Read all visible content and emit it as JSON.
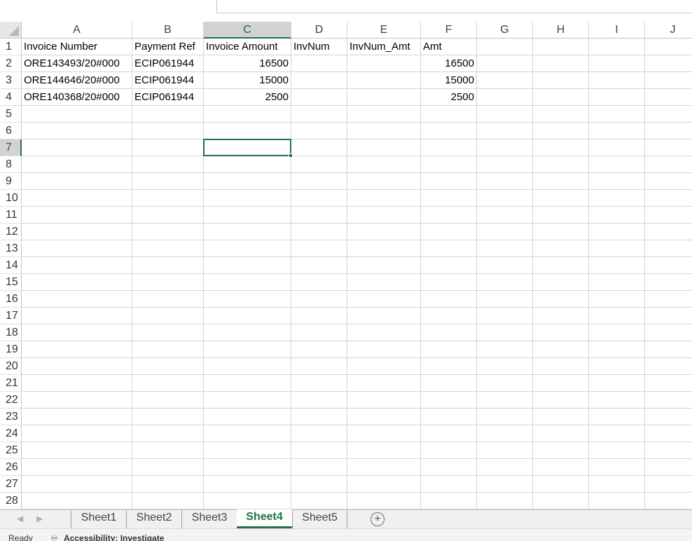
{
  "spreadsheet": {
    "columns": [
      "A",
      "B",
      "C",
      "D",
      "E",
      "F",
      "G",
      "H",
      "I",
      "J"
    ],
    "rows": [
      "1",
      "2",
      "3",
      "4",
      "5",
      "6",
      "7",
      "8",
      "9",
      "10",
      "11",
      "12",
      "13",
      "14",
      "15",
      "16",
      "17",
      "18",
      "19",
      "20",
      "21",
      "22",
      "23",
      "24",
      "25",
      "26",
      "27",
      "28"
    ],
    "selected_column": "C",
    "selected_row": "7",
    "cells": {
      "A1": "Invoice Number",
      "B1": "Payment Ref",
      "C1": "Invoice Amount",
      "D1": "InvNum",
      "E1": "InvNum_Amt",
      "F1": "Amt",
      "A2": "ORE143493/20#000",
      "B2": "ECIP061944",
      "C2": "16500",
      "F2": "16500",
      "A3": "ORE144646/20#000",
      "B3": "ECIP061944",
      "C3": "15000",
      "F3": "15000",
      "A4": "ORE140368/20#000",
      "B4": "ECIP061944",
      "C4": "2500",
      "F4": "2500"
    }
  },
  "sheet_tabs": [
    {
      "label": "Sheet1",
      "active": false
    },
    {
      "label": "Sheet2",
      "active": false
    },
    {
      "label": "Sheet3",
      "active": false
    },
    {
      "label": "Sheet4",
      "active": true
    },
    {
      "label": "Sheet5",
      "active": false
    }
  ],
  "add_sheet_glyph": "+",
  "status_bar": {
    "ready": "Ready",
    "accessibility": "Accessibility: Investigate"
  },
  "icons": {
    "nav_prev": "chevron-left-icon",
    "nav_next": "chevron-right-icon",
    "add_sheet": "plus-circle-icon",
    "accessibility": "accessibility-icon"
  },
  "colors": {
    "accent": "#217346",
    "header_selected_bg": "#d2d2d2"
  }
}
